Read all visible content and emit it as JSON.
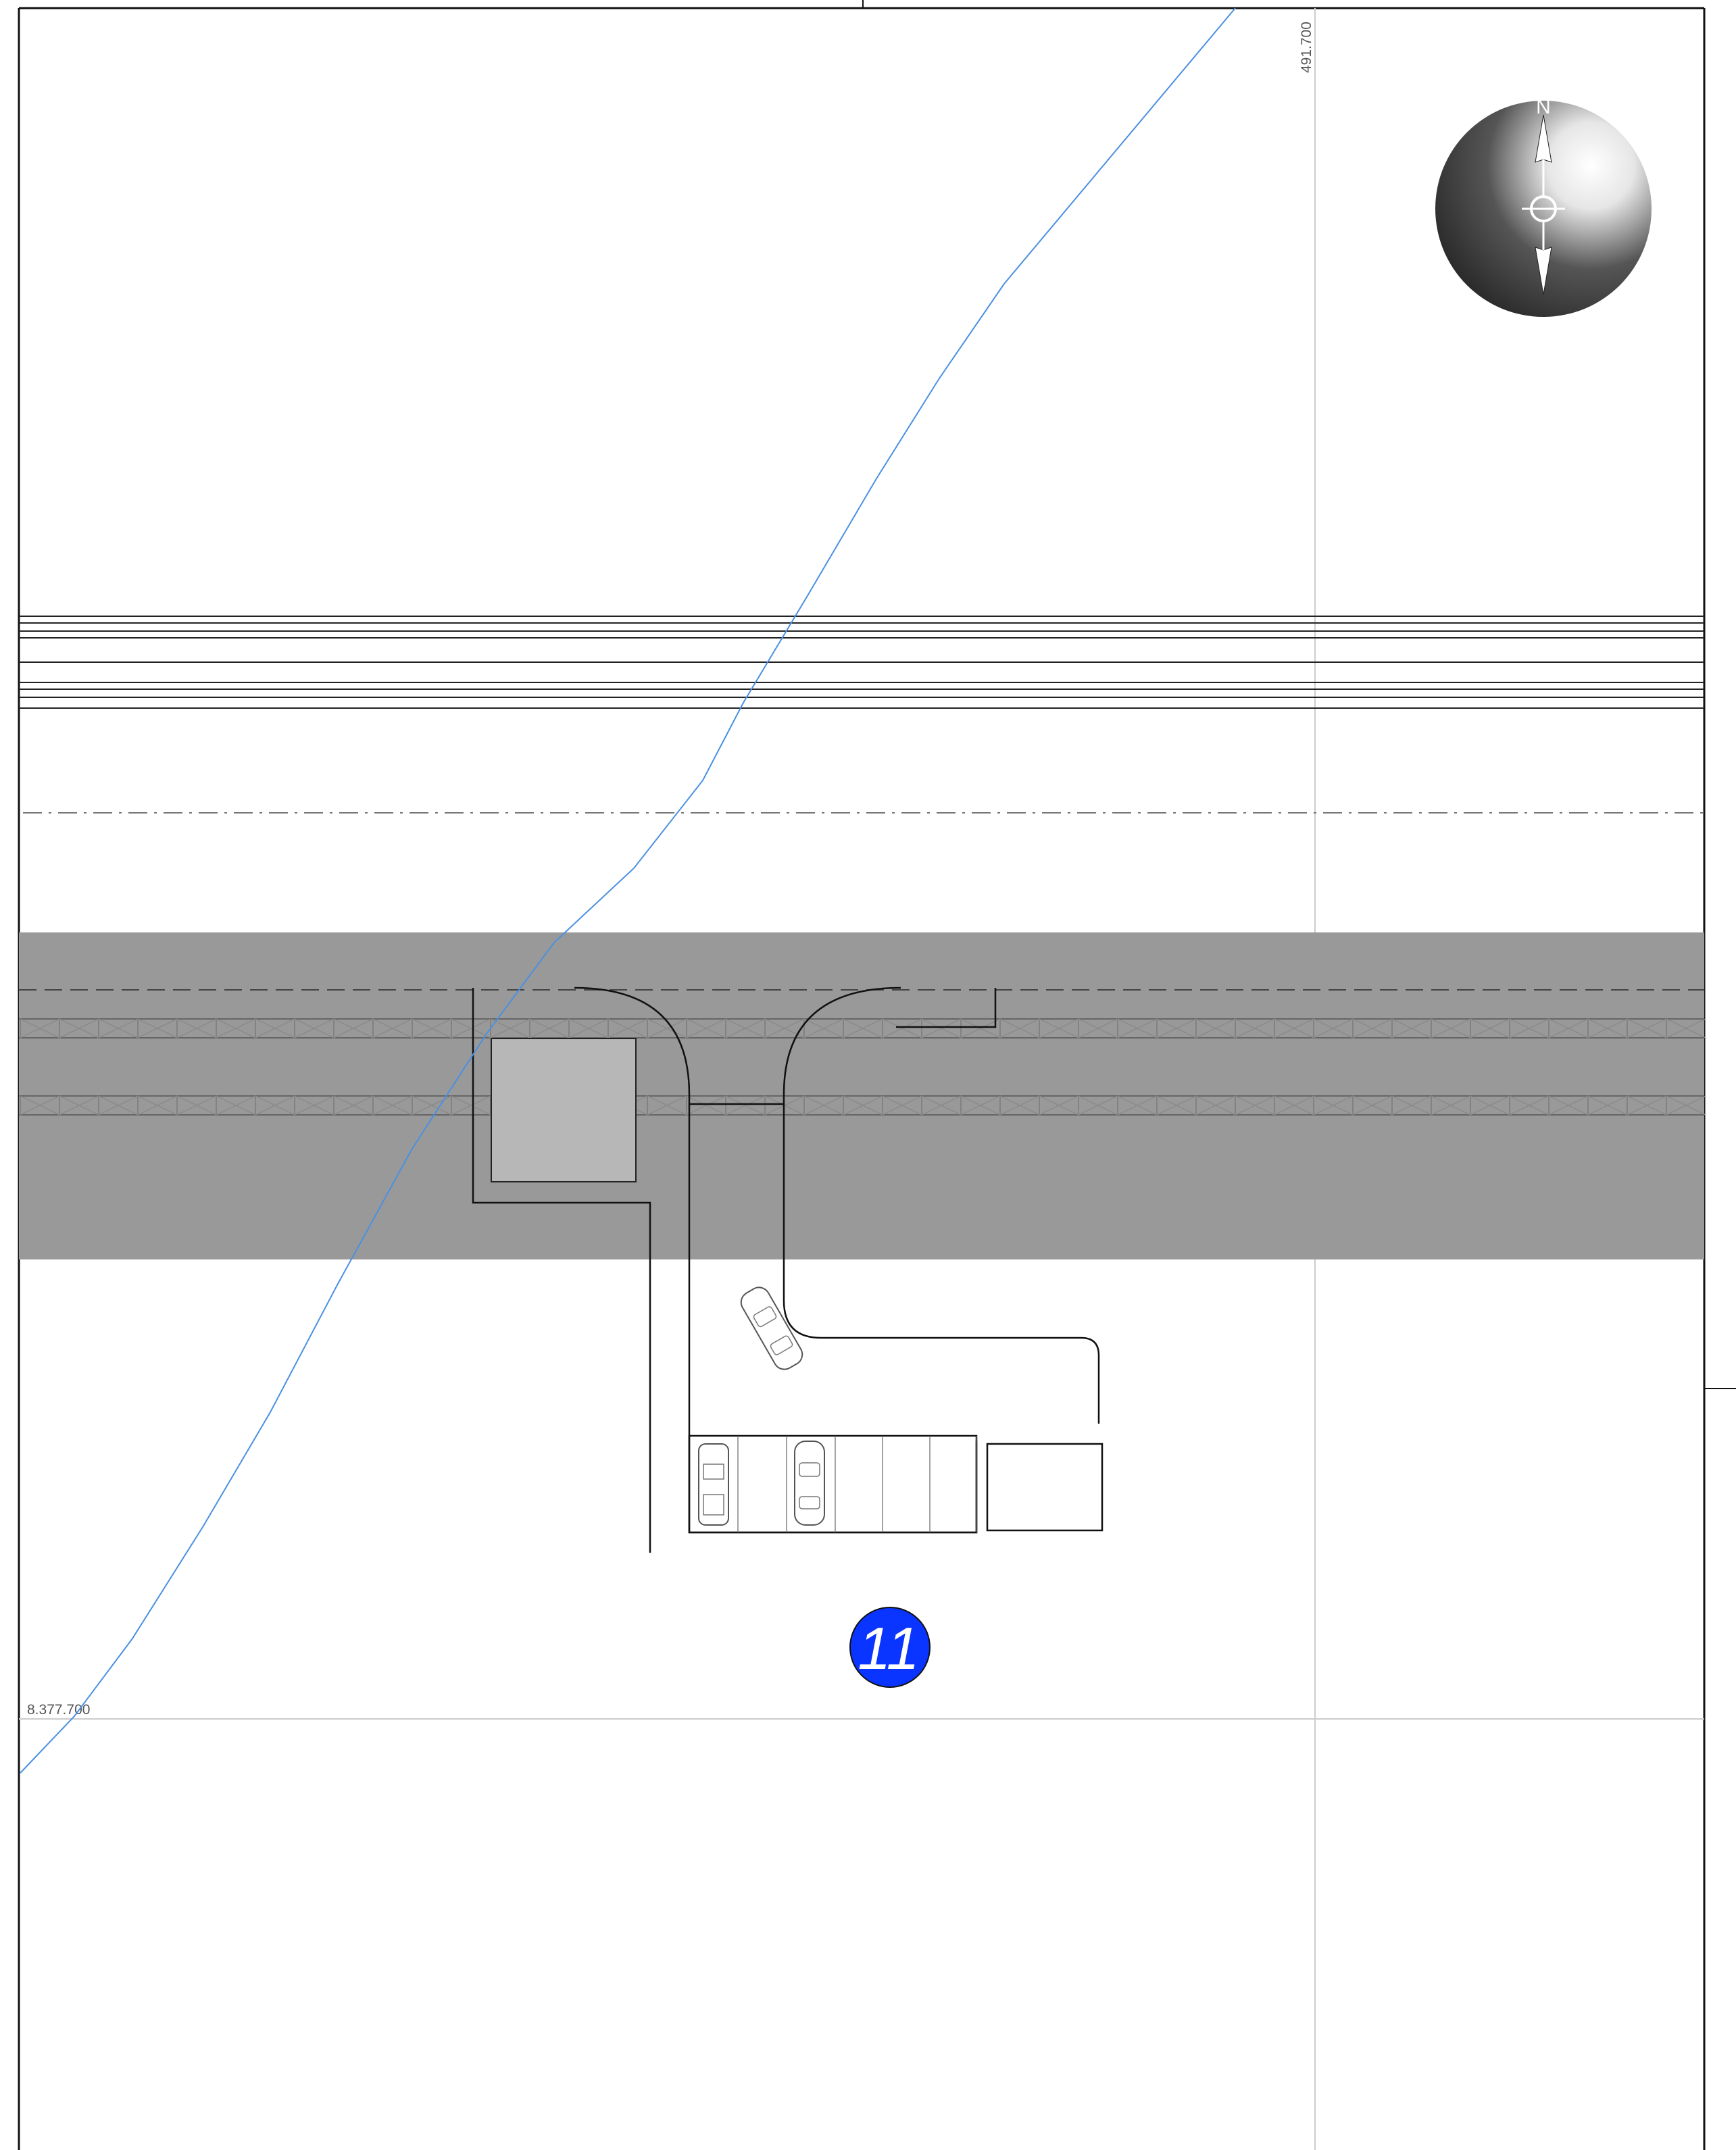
{
  "grid_labels": {
    "easting": "491.700",
    "northing": "8.377.700"
  },
  "plot_badge": {
    "number": "11",
    "color": "#0a34ff"
  },
  "north_arrow": {
    "label": "N"
  },
  "colors": {
    "road_band": "#999999",
    "building": "#b7b7b7",
    "contour_line": "#4a90e2",
    "grid_line": "#cccccc",
    "frame": "#111111",
    "hatch": "#8a8a8a"
  }
}
